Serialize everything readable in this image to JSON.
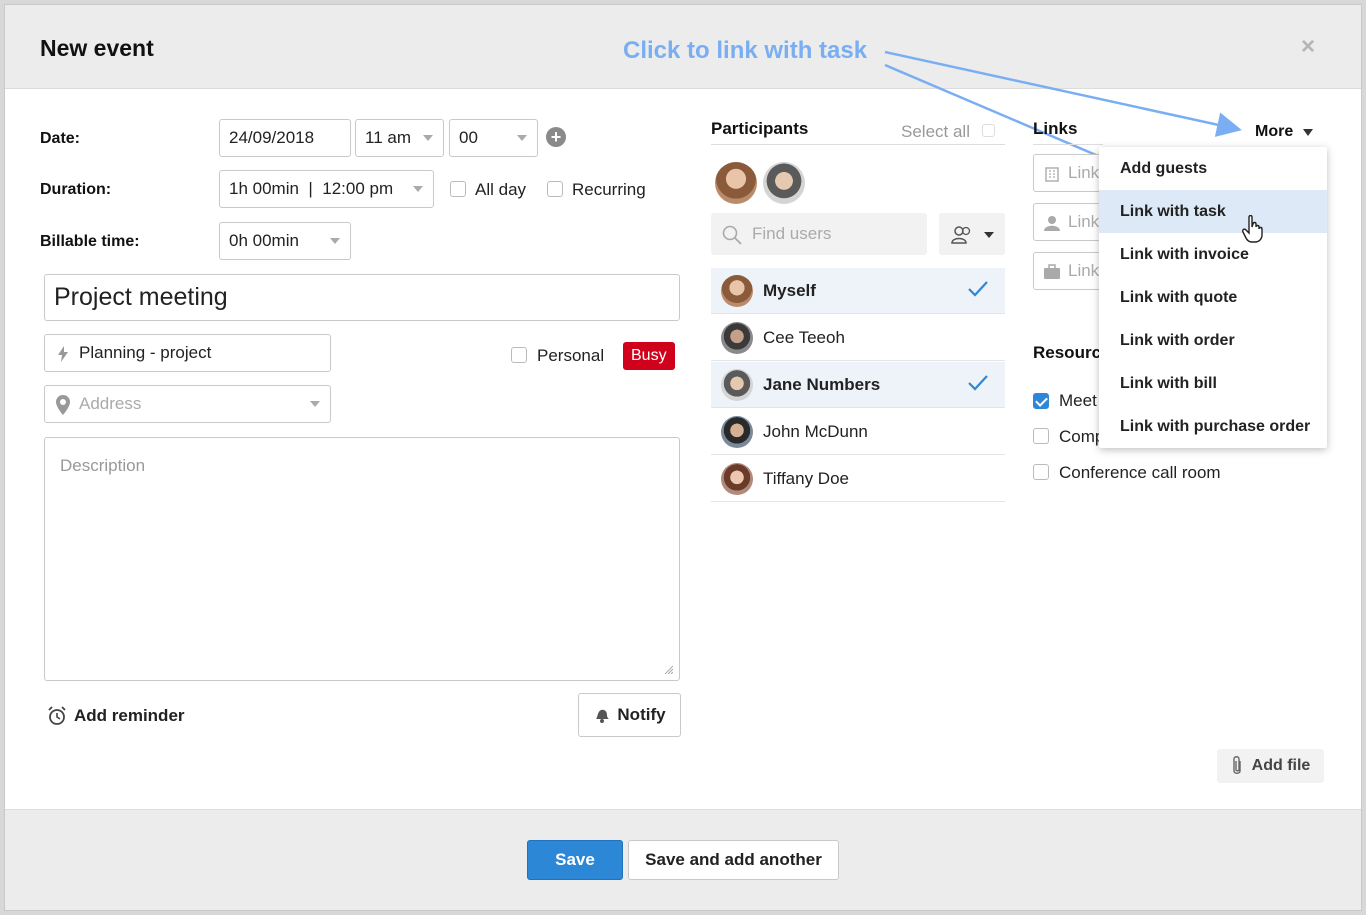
{
  "dialog": {
    "title": "New event",
    "close_glyph": "×"
  },
  "annotation": {
    "text": "Click to link with task"
  },
  "form": {
    "date_label": "Date:",
    "date_value": "24/09/2018",
    "hour_value": "11 am",
    "minute_value": "00",
    "duration_label": "Duration:",
    "duration_value": "1h 00min  |  12:00 pm",
    "allday_label": "All day",
    "recurring_label": "Recurring",
    "billable_label": "Billable time:",
    "billable_value": "0h 00min",
    "event_title": "Project meeting",
    "category_value": "Planning - project",
    "personal_label": "Personal",
    "busy_label": "Busy",
    "address_placeholder": "Address",
    "description_placeholder": "Description",
    "add_reminder_label": "Add reminder",
    "notify_label": "Notify"
  },
  "participants": {
    "header": "Participants",
    "select_all_label": "Select all",
    "find_placeholder": "Find users",
    "list": [
      {
        "name": "Myself",
        "selected": true
      },
      {
        "name": "Cee Teeoh",
        "selected": false
      },
      {
        "name": "Jane Numbers",
        "selected": true
      },
      {
        "name": "John McDunn",
        "selected": false
      },
      {
        "name": "Tiffany Doe",
        "selected": false
      }
    ]
  },
  "links": {
    "header": "Links",
    "more_label": "More",
    "field_placeholder": "Link",
    "menu": [
      "Add guests",
      "Link with task",
      "Link with invoice",
      "Link with quote",
      "Link with order",
      "Link with bill",
      "Link with purchase order"
    ],
    "highlighted_item": "Link with task"
  },
  "resources": {
    "header": "Resources",
    "header_visible": "Resourc",
    "items": [
      {
        "label": "Meet",
        "checked": true
      },
      {
        "label": "Comp",
        "checked": false
      },
      {
        "label": "Conference call room",
        "checked": false
      }
    ]
  },
  "add_file_label": "Add file",
  "footer": {
    "save_label": "Save",
    "save_another_label": "Save and add another"
  },
  "colors": {
    "primary": "#2c87d6",
    "busy": "#d0021b",
    "annotation": "#7aaef2",
    "selected_row": "#edf3f9",
    "check": "#2e86d6"
  }
}
